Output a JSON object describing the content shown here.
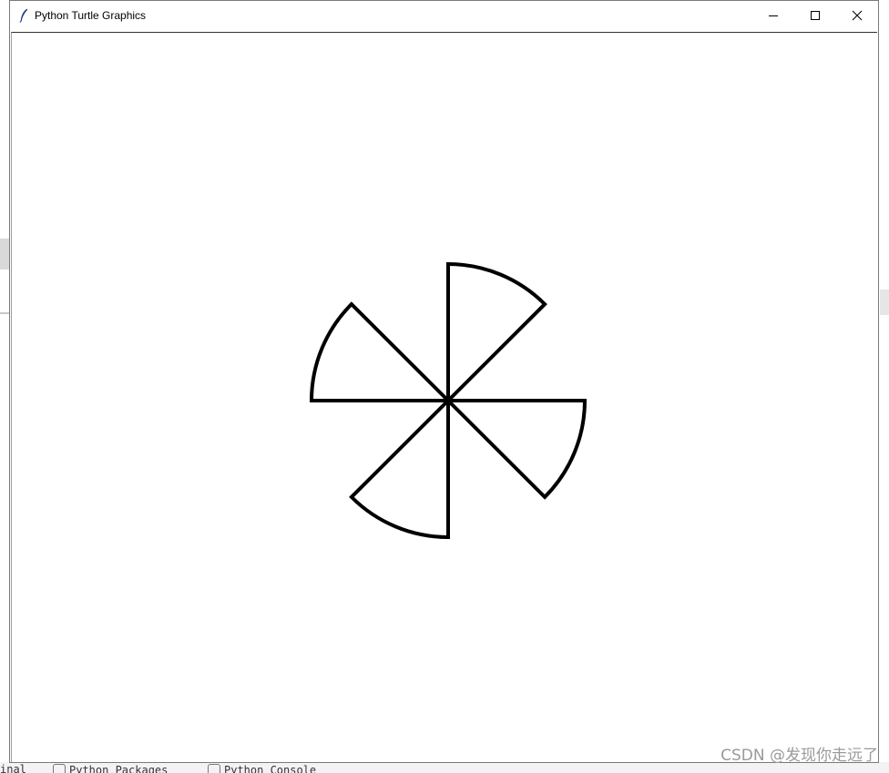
{
  "window": {
    "title": "Python Turtle Graphics",
    "icon": "feather-icon",
    "controls": [
      "minimize-icon",
      "maximize-icon",
      "close-icon"
    ]
  },
  "canvas": {
    "background": "#ffffff",
    "stroke_color": "#000000",
    "shape": "pinwheel-four-blades"
  },
  "ide_bottom_bar": {
    "items": [
      "inal",
      "Python Packages",
      "Python Console"
    ]
  },
  "watermark": "CSDN @发现你走远了"
}
